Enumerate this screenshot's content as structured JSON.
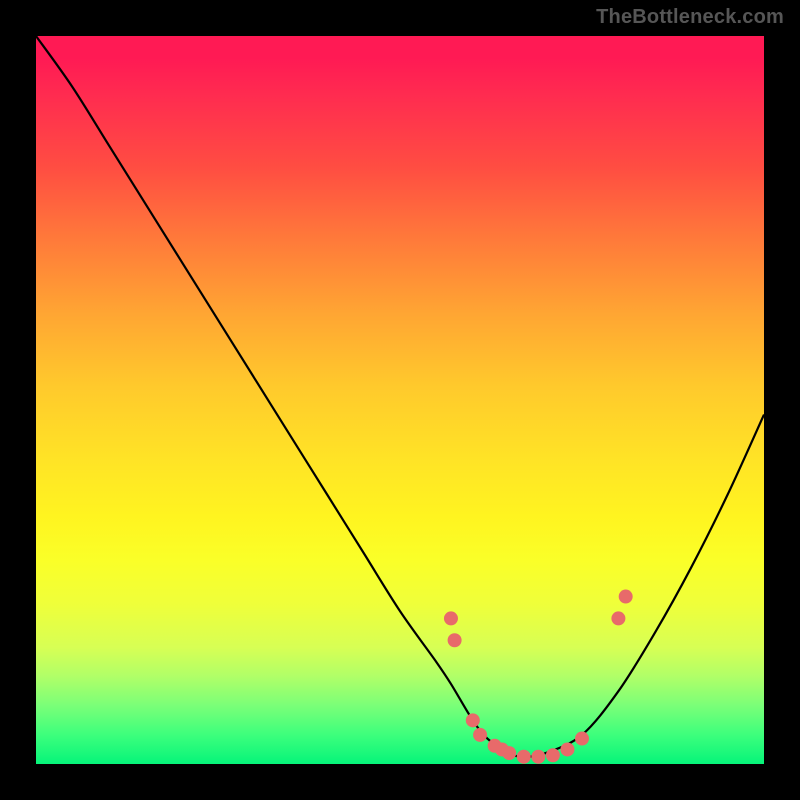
{
  "watermark": "TheBottleneck.com",
  "colors": {
    "background": "#000000",
    "curve": "#000000",
    "marker": "#e86a6a",
    "gradient_top": "#ff1a54",
    "gradient_bottom": "#06f47a"
  },
  "chart_data": {
    "type": "line",
    "title": "",
    "xlabel": "",
    "ylabel": "",
    "xlim": [
      0,
      100
    ],
    "ylim": [
      0,
      100
    ],
    "series": [
      {
        "name": "bottleneck-curve",
        "x": [
          0,
          5,
          10,
          15,
          20,
          25,
          30,
          35,
          40,
          45,
          50,
          55,
          57,
          60,
          62,
          65,
          67,
          70,
          75,
          80,
          85,
          90,
          95,
          100
        ],
        "y": [
          100,
          93,
          85,
          77,
          69,
          61,
          53,
          45,
          37,
          29,
          21,
          14,
          11,
          6,
          3.5,
          1.5,
          1,
          1.5,
          4,
          10,
          18,
          27,
          37,
          48
        ]
      }
    ],
    "markers": {
      "name": "highlight-points",
      "x": [
        57,
        57.5,
        60,
        61,
        63,
        64,
        65,
        67,
        69,
        71,
        73,
        75,
        80,
        81
      ],
      "y": [
        20,
        17,
        6,
        4,
        2.5,
        2,
        1.5,
        1,
        1,
        1.2,
        2,
        3.5,
        20,
        23
      ]
    }
  }
}
